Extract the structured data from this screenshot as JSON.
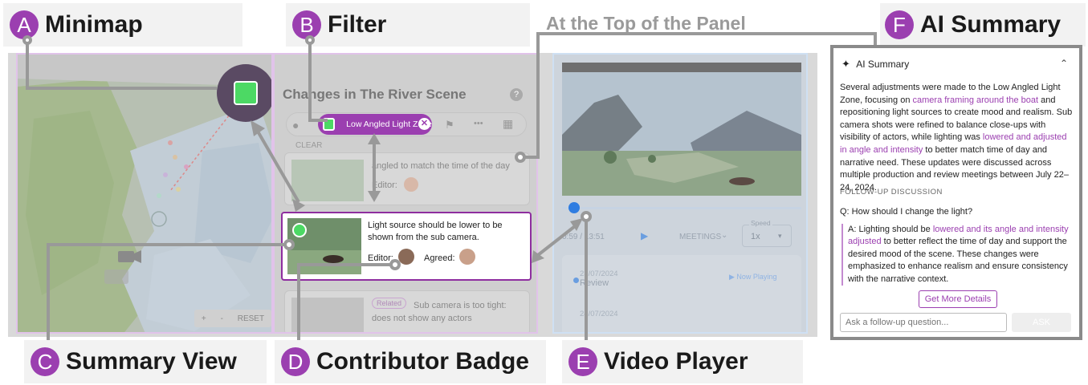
{
  "callouts": {
    "a": {
      "letter": "A",
      "title": "Minimap"
    },
    "b": {
      "letter": "B",
      "title": "Filter"
    },
    "c": {
      "letter": "C",
      "title": "Summary View"
    },
    "d": {
      "letter": "D",
      "title": "Contributor Badge"
    },
    "e": {
      "letter": "E",
      "title": "Video Player"
    },
    "f": {
      "letter": "F",
      "title": "AI Summary"
    },
    "top_label": "At the Top of the Panel"
  },
  "minimap": {
    "zoom_in": "+",
    "zoom_out": "-",
    "reset": "RESET"
  },
  "panel": {
    "title": "Changes in The River Scene",
    "help": "?",
    "active_filter": "Low Angled Light Zone",
    "clear": "CLEAR",
    "cards": [
      {
        "text": "angled to match the time of the day",
        "editor_label": "Editor:"
      },
      {
        "text": "Light source should be lower to be shown from the sub camera.",
        "editor_label": "Editor:",
        "agreed_label": "Agreed:"
      },
      {
        "tag": "Related",
        "text": "Sub camera is too tight: does not show any actors"
      }
    ]
  },
  "player": {
    "time": "0:59 / 13:51",
    "meetings": "MEETINGS",
    "speed_label": "Speed",
    "speed_value": "1x",
    "meetings_list": [
      {
        "date": "23/07/2024",
        "name": "Review",
        "status": "Now Playing"
      },
      {
        "date": "24/07/2024"
      }
    ]
  },
  "ai": {
    "header": "AI Summary",
    "summary_parts": [
      {
        "t": "Several adjustments were made to the Low Angled Light Zone, focusing on "
      },
      {
        "t": "camera framing around the boat",
        "hl": true
      },
      {
        "t": " and repositioning light sources to create mood and realism. Sub camera shots were refined to balance close-ups with visibility of actors, while lighting was "
      },
      {
        "t": "lowered and adjusted in angle and intensity",
        "hl": true
      },
      {
        "t": " to better match time of day and narrative need. These updates were discussed across multiple production and review meetings between July 22–24, 2024."
      }
    ],
    "followup_title": "FOLLOW-UP DISCUSSION",
    "question": "Q: How should I change the light?",
    "answer_prefix": "A: ",
    "answer_parts": [
      {
        "t": "Lighting should be "
      },
      {
        "t": "lowered and its angle and intensity adjusted",
        "hl": true
      },
      {
        "t": " to better reflect the time of day and support the desired mood of the scene. These changes were emphasized to enhance realism and ensure consistency with the narrative context."
      }
    ],
    "more_button": "Get More Details",
    "ask_placeholder": "Ask a follow-up question...",
    "ask_button": "ASK"
  },
  "colors": {
    "accent": "#9b3fb0",
    "callout_bg": "#f2f2f2",
    "arrow": "#999999",
    "green": "#4cd964"
  }
}
